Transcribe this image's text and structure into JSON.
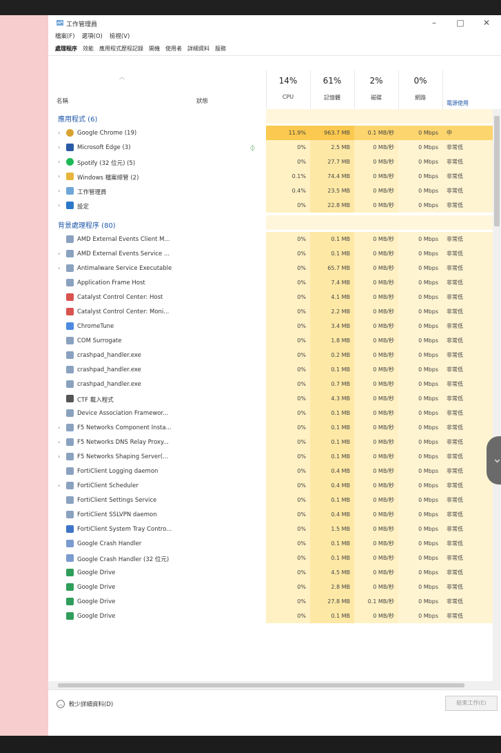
{
  "window": {
    "title": "工作管理員",
    "controls": {
      "minimize": "–",
      "maximize": "□",
      "close": "✕"
    }
  },
  "menu": [
    "檔案(F)",
    "選項(O)",
    "檢視(V)"
  ],
  "tabs": [
    "處理程序",
    "效能",
    "應用程式歷程記錄",
    "開機",
    "使用者",
    "詳細資料",
    "服務"
  ],
  "columns": {
    "name": "名稱",
    "status": "狀態",
    "cpu": {
      "pct": "14%",
      "label": "CPU"
    },
    "memory": {
      "pct": "61%",
      "label": "記憶體"
    },
    "disk": {
      "pct": "2%",
      "label": "磁碟"
    },
    "network": {
      "pct": "0%",
      "label": "網路"
    },
    "power": "電源使用"
  },
  "groups": {
    "apps": "應用程式 (6)",
    "background": "背景處理程序 (80)"
  },
  "apps": [
    {
      "name": "Google Chrome (19)",
      "cpu": "11.9%",
      "mem": "963.7 MB",
      "disk": "0.1 MB/秒",
      "net": "0 Mbps",
      "power": "中",
      "icon": "chrome-icon",
      "expand": true,
      "highlight": true
    },
    {
      "name": "Microsoft Edge (3)",
      "cpu": "0%",
      "mem": "2.5 MB",
      "disk": "0 MB/秒",
      "net": "0 Mbps",
      "power": "非常低",
      "icon": "edge-icon",
      "expand": true,
      "status": "leaf"
    },
    {
      "name": "Spotify (32 位元) (5)",
      "cpu": "0%",
      "mem": "27.7 MB",
      "disk": "0 MB/秒",
      "net": "0 Mbps",
      "power": "非常低",
      "icon": "spotify-icon",
      "expand": true
    },
    {
      "name": "Windows 檔案總管 (2)",
      "cpu": "0.1%",
      "mem": "74.4 MB",
      "disk": "0 MB/秒",
      "net": "0 Mbps",
      "power": "非常低",
      "icon": "folder-icon",
      "expand": true
    },
    {
      "name": "工作管理員",
      "cpu": "0.4%",
      "mem": "23.5 MB",
      "disk": "0 MB/秒",
      "net": "0 Mbps",
      "power": "非常低",
      "icon": "taskmgr-icon",
      "expand": true
    },
    {
      "name": "設定",
      "cpu": "0%",
      "mem": "22.8 MB",
      "disk": "0 MB/秒",
      "net": "0 Mbps",
      "power": "非常低",
      "icon": "settings-icon",
      "expand": true
    }
  ],
  "background": [
    {
      "name": "AMD External Events Client M...",
      "cpu": "0%",
      "mem": "0.1 MB",
      "disk": "0 MB/秒",
      "net": "0 Mbps",
      "power": "非常低",
      "icon": "service-icon",
      "expand": false
    },
    {
      "name": "AMD External Events Service ...",
      "cpu": "0%",
      "mem": "0.1 MB",
      "disk": "0 MB/秒",
      "net": "0 Mbps",
      "power": "非常低",
      "icon": "service-icon",
      "expand": true
    },
    {
      "name": "Antimalware Service Executable",
      "cpu": "0%",
      "mem": "65.7 MB",
      "disk": "0 MB/秒",
      "net": "0 Mbps",
      "power": "非常低",
      "icon": "service-icon",
      "expand": true
    },
    {
      "name": "Application Frame Host",
      "cpu": "0%",
      "mem": "7.4 MB",
      "disk": "0 MB/秒",
      "net": "0 Mbps",
      "power": "非常低",
      "icon": "service-icon",
      "expand": false
    },
    {
      "name": "Catalyst Control Center: Host",
      "cpu": "0%",
      "mem": "4.1 MB",
      "disk": "0 MB/秒",
      "net": "0 Mbps",
      "power": "非常低",
      "icon": "amd-icon",
      "expand": false
    },
    {
      "name": "Catalyst Control Center: Moni...",
      "cpu": "0%",
      "mem": "2.2 MB",
      "disk": "0 MB/秒",
      "net": "0 Mbps",
      "power": "非常低",
      "icon": "amd-icon",
      "expand": false
    },
    {
      "name": "ChromeTune",
      "cpu": "0%",
      "mem": "3.4 MB",
      "disk": "0 MB/秒",
      "net": "0 Mbps",
      "power": "非常低",
      "icon": "chrometune-icon",
      "expand": false
    },
    {
      "name": "COM Surrogate",
      "cpu": "0%",
      "mem": "1.8 MB",
      "disk": "0 MB/秒",
      "net": "0 Mbps",
      "power": "非常低",
      "icon": "service-icon",
      "expand": false
    },
    {
      "name": "crashpad_handler.exe",
      "cpu": "0%",
      "mem": "0.2 MB",
      "disk": "0 MB/秒",
      "net": "0 Mbps",
      "power": "非常低",
      "icon": "service-icon",
      "expand": false
    },
    {
      "name": "crashpad_handler.exe",
      "cpu": "0%",
      "mem": "0.1 MB",
      "disk": "0 MB/秒",
      "net": "0 Mbps",
      "power": "非常低",
      "icon": "service-icon",
      "expand": false
    },
    {
      "name": "crashpad_handler.exe",
      "cpu": "0%",
      "mem": "0.7 MB",
      "disk": "0 MB/秒",
      "net": "0 Mbps",
      "power": "非常低",
      "icon": "service-icon",
      "expand": false
    },
    {
      "name": "CTF 載入程式",
      "cpu": "0%",
      "mem": "4.3 MB",
      "disk": "0 MB/秒",
      "net": "0 Mbps",
      "power": "非常低",
      "icon": "ctf-icon",
      "expand": false
    },
    {
      "name": "Device Association Framewor...",
      "cpu": "0%",
      "mem": "0.1 MB",
      "disk": "0 MB/秒",
      "net": "0 Mbps",
      "power": "非常低",
      "icon": "service-icon",
      "expand": false
    },
    {
      "name": "F5 Networks Component Insta...",
      "cpu": "0%",
      "mem": "0.1 MB",
      "disk": "0 MB/秒",
      "net": "0 Mbps",
      "power": "非常低",
      "icon": "service-icon",
      "expand": true
    },
    {
      "name": "F5 Networks DNS Relay Proxy...",
      "cpu": "0%",
      "mem": "0.1 MB",
      "disk": "0 MB/秒",
      "net": "0 Mbps",
      "power": "非常低",
      "icon": "service-icon",
      "expand": true
    },
    {
      "name": "F5 Networks Shaping Server(...",
      "cpu": "0%",
      "mem": "0.1 MB",
      "disk": "0 MB/秒",
      "net": "0 Mbps",
      "power": "非常低",
      "icon": "service-icon",
      "expand": true
    },
    {
      "name": "FortiClient Logging daemon",
      "cpu": "0%",
      "mem": "0.4 MB",
      "disk": "0 MB/秒",
      "net": "0 Mbps",
      "power": "非常低",
      "icon": "service-icon",
      "expand": false
    },
    {
      "name": "FortiClient Scheduler",
      "cpu": "0%",
      "mem": "0.4 MB",
      "disk": "0 MB/秒",
      "net": "0 Mbps",
      "power": "非常低",
      "icon": "service-icon",
      "expand": true
    },
    {
      "name": "FortiClient Settings Service",
      "cpu": "0%",
      "mem": "0.1 MB",
      "disk": "0 MB/秒",
      "net": "0 Mbps",
      "power": "非常低",
      "icon": "service-icon",
      "expand": false
    },
    {
      "name": "FortiClient SSLVPN daemon",
      "cpu": "0%",
      "mem": "0.4 MB",
      "disk": "0 MB/秒",
      "net": "0 Mbps",
      "power": "非常低",
      "icon": "service-icon",
      "expand": false
    },
    {
      "name": "FortiClient System Tray Contro...",
      "cpu": "0%",
      "mem": "1.5 MB",
      "disk": "0 MB/秒",
      "net": "0 Mbps",
      "power": "非常低",
      "icon": "shield-icon",
      "expand": false
    },
    {
      "name": "Google Crash Handler",
      "cpu": "0%",
      "mem": "0.1 MB",
      "disk": "0 MB/秒",
      "net": "0 Mbps",
      "power": "非常低",
      "icon": "crash-icon",
      "expand": false
    },
    {
      "name": "Google Crash Handler (32 位元)",
      "cpu": "0%",
      "mem": "0.1 MB",
      "disk": "0 MB/秒",
      "net": "0 Mbps",
      "power": "非常低",
      "icon": "crash-icon",
      "expand": false
    },
    {
      "name": "Google Drive",
      "cpu": "0%",
      "mem": "4.5 MB",
      "disk": "0 MB/秒",
      "net": "0 Mbps",
      "power": "非常低",
      "icon": "drive-icon",
      "expand": false
    },
    {
      "name": "Google Drive",
      "cpu": "0%",
      "mem": "2.8 MB",
      "disk": "0 MB/秒",
      "net": "0 Mbps",
      "power": "非常低",
      "icon": "drive-icon",
      "expand": false
    },
    {
      "name": "Google Drive",
      "cpu": "0%",
      "mem": "27.8 MB",
      "disk": "0.1 MB/秒",
      "net": "0 Mbps",
      "power": "非常低",
      "icon": "drive-icon",
      "expand": false
    },
    {
      "name": "Google Drive",
      "cpu": "0%",
      "mem": "0.1 MB",
      "disk": "0 MB/秒",
      "net": "0 Mbps",
      "power": "非常低",
      "icon": "drive-icon",
      "expand": false
    }
  ],
  "footer": {
    "fewer_details": "較少詳細資料(D)",
    "end_task": "結束工作(E)"
  },
  "colors": {
    "accent": "#1f56a8",
    "cpu_bg": "#fff1c4",
    "mem_bg": "#fde8a6",
    "disk_bg": "#fff1c4",
    "net_bg": "#fff4d2",
    "highlight": "#fbc94f"
  }
}
